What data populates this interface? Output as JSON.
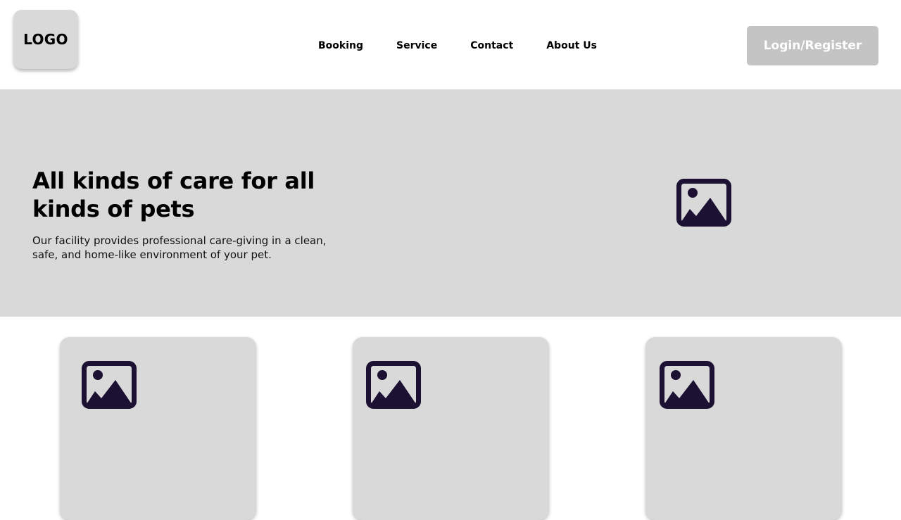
{
  "header": {
    "logo_text": "LOGO",
    "nav": [
      {
        "label": "Booking"
      },
      {
        "label": "Service"
      },
      {
        "label": "Contact"
      },
      {
        "label": "About Us"
      }
    ],
    "login_label": "Login/Register"
  },
  "hero": {
    "title": "All kinds of care for all kinds of pets",
    "description": "Our facility provides professional care-giving in a clean, safe, and home-like environment of your pet.",
    "image_icon": "image-placeholder-icon"
  },
  "cards": [
    {
      "icon": "image-placeholder-icon"
    },
    {
      "icon": "image-placeholder-icon"
    },
    {
      "icon": "image-placeholder-icon"
    }
  ],
  "colors": {
    "hero_bg": "#d9d9d9",
    "button_bg": "#c4c4c4",
    "icon": "#1c1033"
  }
}
